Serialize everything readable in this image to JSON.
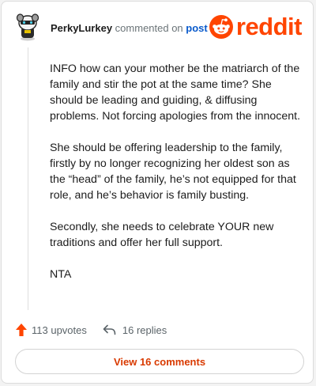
{
  "header": {
    "username": "PerkyLurkey",
    "action_text": " commented on ",
    "post_link": "post",
    "logo_text": "reddit"
  },
  "comment": {
    "paragraphs": [
      "INFO how can your mother be the matriarch of the family and stir the pot at the same time? She should be leading and guiding, & diffusing problems. Not forcing apologies from the innocent.",
      "She should be offering leadership to the family, firstly by no longer recognizing her oldest son as the “head” of the family, he’s not equipped for that role, and he’s behavior is family busting.",
      "Secondly, she needs to celebrate YOUR new traditions and offer her full support.",
      "NTA"
    ]
  },
  "actions": {
    "upvotes": "113 upvotes",
    "replies": "16 replies"
  },
  "view_button": "View 16 comments",
  "colors": {
    "brand": "#ff4500",
    "link": "#0a5bcc",
    "button_text": "#d93a00"
  },
  "icons": [
    "avatar",
    "reddit-snoo-icon",
    "upvote-arrow-icon",
    "reply-arrow-icon"
  ]
}
